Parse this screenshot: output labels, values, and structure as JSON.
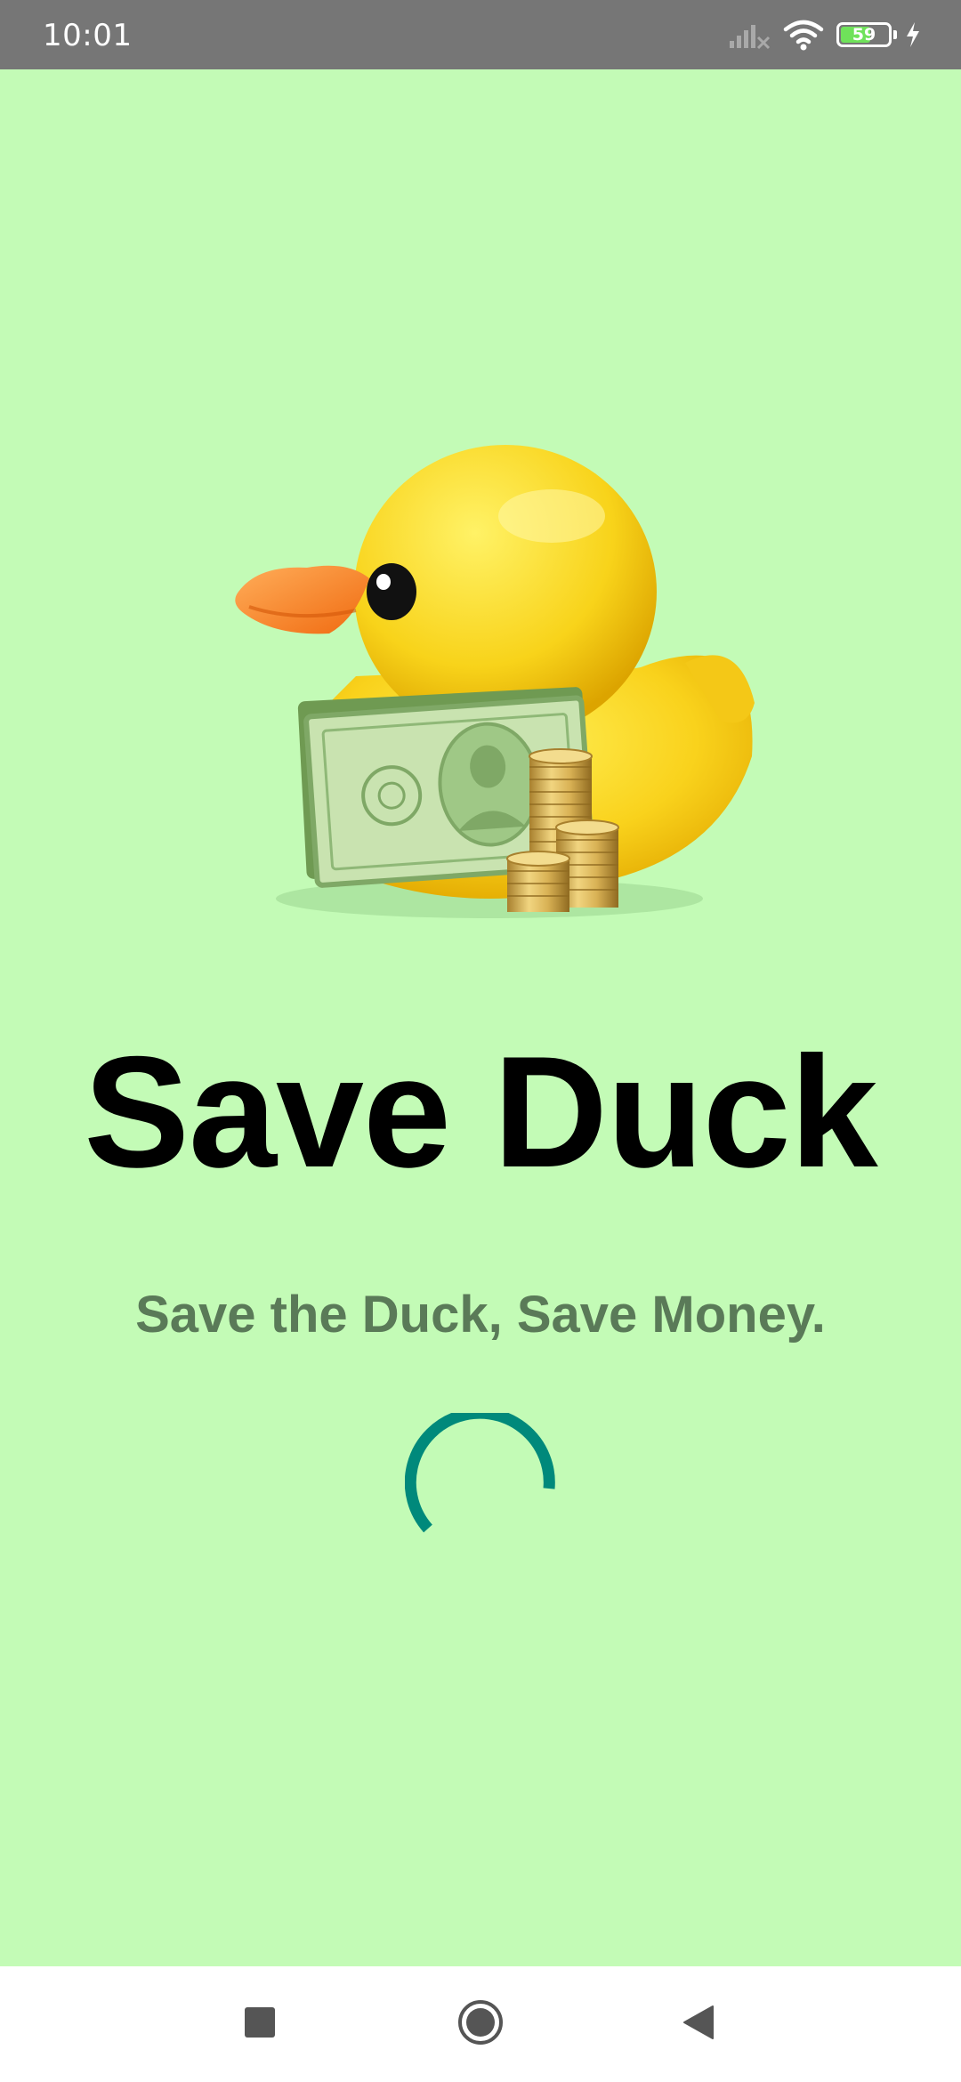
{
  "status_bar": {
    "time": "10:01",
    "battery_percent": 59,
    "battery_label": "59",
    "icons": [
      "signal-icon",
      "wifi-icon",
      "battery-icon",
      "charging-icon"
    ]
  },
  "splash": {
    "hero_image": "duck-with-money-illustration",
    "title": "Save Duck",
    "tagline": "Save the Duck, Save Money.",
    "loading_indicator": "spinner"
  },
  "nav_bar": {
    "buttons": [
      "recents-button",
      "home-button",
      "back-button"
    ]
  },
  "colors": {
    "background": "#c3fbb6",
    "status_bar": "#767676",
    "title": "#000000",
    "tagline": "#5a7a58",
    "spinner": "#00897b"
  }
}
